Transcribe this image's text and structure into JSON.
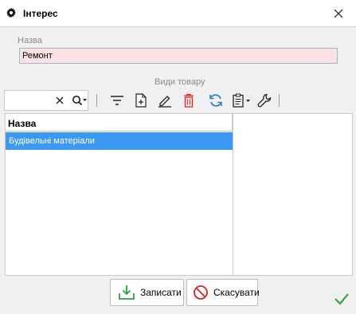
{
  "window": {
    "title": "Інтерес"
  },
  "form": {
    "name_label": "Назва",
    "name_value": "Ремонт",
    "group_label": "Види товару"
  },
  "search": {
    "value": ""
  },
  "toolbar": {
    "icons": [
      "clear-icon",
      "search-icon",
      "filter-icon",
      "add-icon",
      "edit-icon",
      "delete-icon",
      "refresh-icon",
      "clipboard-icon",
      "settings-wrench-icon"
    ]
  },
  "grid": {
    "columns": [
      "Назва"
    ],
    "rows": [
      {
        "name": "Будівельні матеріали",
        "selected": true
      }
    ]
  },
  "buttons": {
    "save": "Записати",
    "cancel": "Скасувати"
  },
  "colors": {
    "selection": "#3d98f2",
    "required_field_bg": "#fde2e4",
    "save_icon": "#2e9e3e",
    "cancel_icon": "#e02020",
    "delete_icon": "#e02020",
    "refresh_icon": "#1e7fd0",
    "status_check": "#3aa53a"
  }
}
